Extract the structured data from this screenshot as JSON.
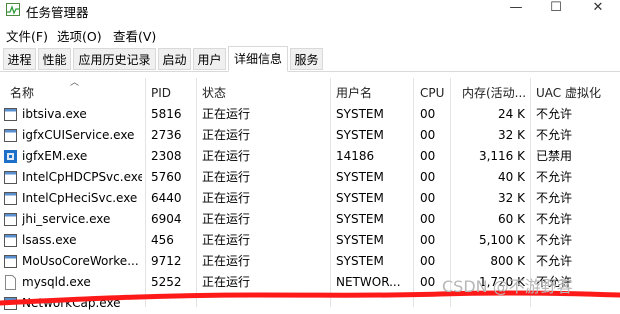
{
  "window": {
    "title": "任务管理器",
    "minimize_glyph": "—",
    "maximize_glyph": "☐",
    "close_glyph": "✕"
  },
  "menu": [
    "文件(F)",
    "选项(O)",
    "查看(V)"
  ],
  "tabs": [
    "进程",
    "性能",
    "应用历史记录",
    "启动",
    "用户",
    "详细信息",
    "服务"
  ],
  "active_tab": "详细信息",
  "columns": [
    "名称",
    "PID",
    "状态",
    "用户名",
    "CPU",
    "内存(活动...",
    "UAC 虚拟化"
  ],
  "rows": [
    {
      "name": "ibtsiva.exe",
      "pid": "5816",
      "status": "正在运行",
      "user": "SYSTEM",
      "cpu": "00",
      "mem": "24 K",
      "uac": "不允许",
      "icon": "window-icon"
    },
    {
      "name": "igfxCUIService.exe",
      "pid": "2736",
      "status": "正在运行",
      "user": "SYSTEM",
      "cpu": "00",
      "mem": "32 K",
      "uac": "不允许",
      "icon": "window-icon"
    },
    {
      "name": "igfxEM.exe",
      "pid": "2308",
      "status": "正在运行",
      "user": "14186",
      "cpu": "00",
      "mem": "3,116 K",
      "uac": "已禁用",
      "icon": "intel-graphics-icon"
    },
    {
      "name": "IntelCpHDCPSvc.exe",
      "pid": "5760",
      "status": "正在运行",
      "user": "SYSTEM",
      "cpu": "00",
      "mem": "40 K",
      "uac": "不允许",
      "icon": "window-icon"
    },
    {
      "name": "IntelCpHeciSvc.exe",
      "pid": "6440",
      "status": "正在运行",
      "user": "SYSTEM",
      "cpu": "00",
      "mem": "32 K",
      "uac": "不允许",
      "icon": "window-icon"
    },
    {
      "name": "jhi_service.exe",
      "pid": "6904",
      "status": "正在运行",
      "user": "SYSTEM",
      "cpu": "00",
      "mem": "60 K",
      "uac": "不允许",
      "icon": "window-icon"
    },
    {
      "name": "lsass.exe",
      "pid": "456",
      "status": "正在运行",
      "user": "SYSTEM",
      "cpu": "00",
      "mem": "5,100 K",
      "uac": "不允许",
      "icon": "window-icon"
    },
    {
      "name": "MoUsoCoreWorke...",
      "pid": "9712",
      "status": "正在运行",
      "user": "SYSTEM",
      "cpu": "00",
      "mem": "800 K",
      "uac": "不允许",
      "icon": "window-icon"
    },
    {
      "name": "mysqld.exe",
      "pid": "5252",
      "status": "正在运行",
      "user": "NETWOR...",
      "cpu": "00",
      "mem": "1,720 K",
      "uac": "不允许",
      "icon": "blank-file-icon"
    },
    {
      "name": "NetworkCap.exe",
      "pid": "",
      "status": "",
      "user": "",
      "cpu": "",
      "mem": "",
      "uac": "",
      "icon": "window-icon"
    }
  ],
  "watermark": "CSDN @不游野客",
  "colors": {
    "tab_bg": "#f0f0f0",
    "border": "#d9d9d9",
    "icon_blue": "#1e6fc7",
    "scribble_red": "#ff1a1a"
  }
}
